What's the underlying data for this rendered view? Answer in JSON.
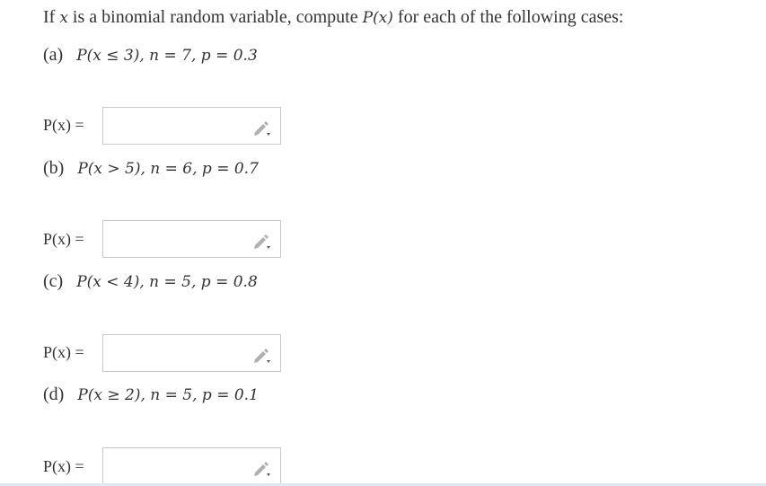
{
  "question": {
    "prefix": "If",
    "var": "x",
    "mid": "is a binomial random variable, compute",
    "func": "P(x)",
    "suffix": "for each of the following cases:"
  },
  "cases": [
    {
      "letter": "(a)",
      "expr": "P(x ≤ 3), n = 7, p = 0.3"
    },
    {
      "letter": "(b)",
      "expr": "P(x > 5), n = 6, p = 0.7"
    },
    {
      "letter": "(c)",
      "expr": "P(x < 4), n = 5, p = 0.8"
    },
    {
      "letter": "(d)",
      "expr": "P(x ≥ 2), n = 5, p = 0.1"
    }
  ],
  "answers": [
    {
      "label": "P(x) =",
      "value": "",
      "icon": "pencil-icon"
    },
    {
      "label": "P(x) =",
      "value": "",
      "icon": "pencil-icon"
    },
    {
      "label": "P(x) =",
      "value": "",
      "icon": "pencil-icon"
    },
    {
      "label": "P(x) =",
      "value": "",
      "icon": "pencil-icon"
    }
  ]
}
